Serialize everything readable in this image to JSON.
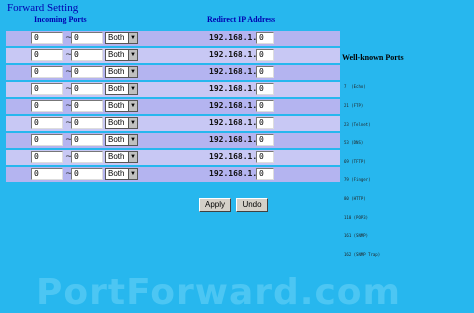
{
  "page": {
    "title": "Forward Setting",
    "headers": {
      "incoming_ports": "Incoming Ports",
      "redirect_ip": "Redirect IP Address"
    },
    "rows": [
      {
        "start": "0",
        "end": "0",
        "protocol": "Both",
        "ip_prefix": "192.168.1.",
        "ip_last": "0"
      },
      {
        "start": "0",
        "end": "0",
        "protocol": "Both",
        "ip_prefix": "192.168.1.",
        "ip_last": "0"
      },
      {
        "start": "0",
        "end": "0",
        "protocol": "Both",
        "ip_prefix": "192.168.1.",
        "ip_last": "0"
      },
      {
        "start": "0",
        "end": "0",
        "protocol": "Both",
        "ip_prefix": "192.168.1.",
        "ip_last": "0"
      },
      {
        "start": "0",
        "end": "0",
        "protocol": "Both",
        "ip_prefix": "192.168.1.",
        "ip_last": "0"
      },
      {
        "start": "0",
        "end": "0",
        "protocol": "Both",
        "ip_prefix": "192.168.1.",
        "ip_last": "0"
      },
      {
        "start": "0",
        "end": "0",
        "protocol": "Both",
        "ip_prefix": "192.168.1.",
        "ip_last": "0"
      },
      {
        "start": "0",
        "end": "0",
        "protocol": "Both",
        "ip_prefix": "192.168.1.",
        "ip_last": "0"
      },
      {
        "start": "0",
        "end": "0",
        "protocol": "Both",
        "ip_prefix": "192.168.1.",
        "ip_last": "0"
      }
    ],
    "tilde": "~"
  },
  "well_known": {
    "title": "Well-known Ports",
    "items": [
      "7  (Echo)",
      "21 (FTP)",
      "23 (Telnet)",
      "53 (DNS)",
      "69 (TFTP)",
      "79 (Finger)",
      "80 (HTTP)",
      "110 (POP3)",
      "161 (SNMP)",
      "162 (SNMP Trap)"
    ]
  },
  "buttons": {
    "apply": "Apply",
    "undo": "Undo"
  },
  "watermark": "PortForward.com",
  "colors": {
    "background": "#27b7ee",
    "row_band": "#b4b4f0",
    "title": "#0000b0"
  }
}
